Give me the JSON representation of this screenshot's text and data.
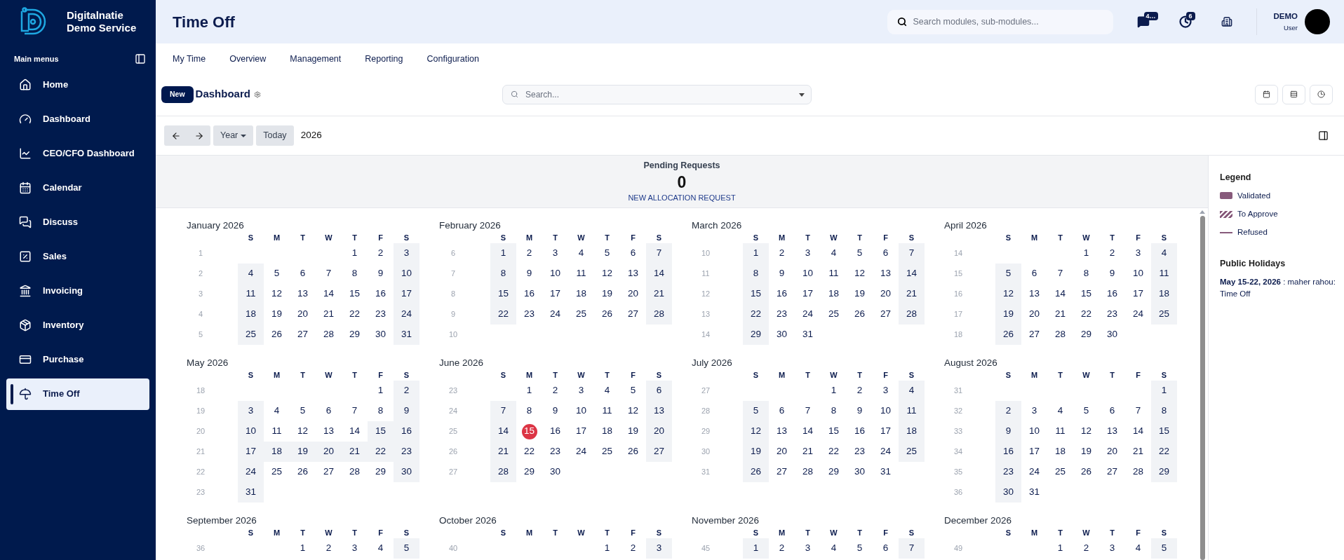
{
  "brand": {
    "lines": [
      "Digitalnatie",
      "Demo Service"
    ]
  },
  "sidebar": {
    "heading": "Main menus",
    "items": [
      {
        "label": "Home",
        "selected": false
      },
      {
        "label": "Dashboard",
        "selected": false
      },
      {
        "label": "CEO/CFO Dashboard",
        "selected": false
      },
      {
        "label": "Calendar",
        "selected": false
      },
      {
        "label": "Discuss",
        "selected": false
      },
      {
        "label": "Sales",
        "selected": false
      },
      {
        "label": "Invoicing",
        "selected": false
      },
      {
        "label": "Inventory",
        "selected": false
      },
      {
        "label": "Purchase",
        "selected": false
      },
      {
        "label": "Time Off",
        "selected": true
      }
    ]
  },
  "header": {
    "title": "Time Off",
    "search": {
      "placeholder": "Search modules, sub-modules..."
    },
    "messages_badge": "4…",
    "activity_badge": "6",
    "user": {
      "name": "DEMO",
      "role": "User"
    }
  },
  "menu": [
    "My Time",
    "Overview",
    "Management",
    "Reporting",
    "Configuration"
  ],
  "control_panel": {
    "new_button": "New",
    "title": "Dashboard",
    "search": {
      "placeholder": "Search..."
    }
  },
  "toolbar": {
    "scale": "Year",
    "today": "Today",
    "period": "2026"
  },
  "pending": {
    "label": "Pending Requests",
    "count": "0",
    "link": "NEW ALLOCATION REQUEST"
  },
  "months": [
    {
      "title": "January 2026",
      "weekdays": [
        "S",
        "M",
        "T",
        "W",
        "T",
        "F",
        "S"
      ],
      "weeks": [
        {
          "number": "1",
          "days": [
            "1",
            "2",
            "3"
          ]
        },
        {
          "number": "2",
          "days": [
            "4",
            "5",
            "6",
            "7",
            "8",
            "9",
            "10"
          ]
        },
        {
          "number": "3",
          "days": [
            "11",
            "12",
            "13",
            "14",
            "15",
            "16",
            "17"
          ]
        },
        {
          "number": "4",
          "days": [
            "18",
            "19",
            "20",
            "21",
            "22",
            "23",
            "24"
          ]
        },
        {
          "number": "5",
          "days": [
            "25",
            "26",
            "27",
            "28",
            "29",
            "30",
            "31"
          ]
        }
      ]
    },
    {
      "title": "February 2026",
      "weekdays": [
        "S",
        "M",
        "T",
        "W",
        "T",
        "F",
        "S"
      ],
      "weeks": [
        {
          "number": "6",
          "days": [
            "1",
            "2",
            "3",
            "4",
            "5",
            "6",
            "7"
          ]
        },
        {
          "number": "7",
          "days": [
            "8",
            "9",
            "10",
            "11",
            "12",
            "13",
            "14"
          ]
        },
        {
          "number": "8",
          "days": [
            "15",
            "16",
            "17",
            "18",
            "19",
            "20",
            "21"
          ]
        },
        {
          "number": "9",
          "days": [
            "22",
            "23",
            "24",
            "25",
            "26",
            "27",
            "28"
          ]
        },
        {
          "number": "10"
        }
      ]
    },
    {
      "title": "March 2026",
      "weekdays": [
        "S",
        "M",
        "T",
        "W",
        "T",
        "F",
        "S"
      ],
      "weeks": [
        {
          "number": "10",
          "days": [
            "1",
            "2",
            "3",
            "4",
            "5",
            "6",
            "7"
          ]
        },
        {
          "number": "11",
          "days": [
            "8",
            "9",
            "10",
            "11",
            "12",
            "13",
            "14"
          ]
        },
        {
          "number": "12",
          "days": [
            "15",
            "16",
            "17",
            "18",
            "19",
            "20",
            "21"
          ]
        },
        {
          "number": "13",
          "days": [
            "22",
            "23",
            "24",
            "25",
            "26",
            "27",
            "28"
          ]
        },
        {
          "number": "14",
          "days": [
            "29",
            "30",
            "31"
          ]
        }
      ]
    },
    {
      "title": "April 2026",
      "weekdays": [
        "S",
        "M",
        "T",
        "W",
        "T",
        "F",
        "S"
      ],
      "weeks": [
        {
          "number": "14",
          "days": [
            "1",
            "2",
            "3",
            "4"
          ]
        },
        {
          "number": "15",
          "days": [
            "5",
            "6",
            "7",
            "8",
            "9",
            "10",
            "11"
          ]
        },
        {
          "number": "16",
          "days": [
            "12",
            "13",
            "14",
            "15",
            "16",
            "17",
            "18"
          ]
        },
        {
          "number": "17",
          "days": [
            "19",
            "20",
            "21",
            "22",
            "23",
            "24",
            "25"
          ]
        },
        {
          "number": "18",
          "days": [
            "26",
            "27",
            "28",
            "29",
            "30"
          ]
        }
      ]
    },
    {
      "title": "May 2026",
      "weekdays": [
        "S",
        "M",
        "T",
        "W",
        "T",
        "F",
        "S"
      ],
      "weeks": [
        {
          "number": "18",
          "days": [
            "1",
            "2"
          ]
        },
        {
          "number": "19",
          "days": [
            "3",
            "4",
            "5",
            "6",
            "7",
            "8",
            "9"
          ]
        },
        {
          "number": "20",
          "days": [
            "10",
            {
              "day": "11",
              "holiday": false
            },
            {
              "day": "12",
              "holiday": false
            },
            {
              "day": "13",
              "holiday": false
            },
            {
              "day": "14",
              "holiday": false
            },
            {
              "day": "15",
              "holiday": true
            },
            "16"
          ]
        },
        {
          "number": "21",
          "days": [
            "17",
            {
              "day": "18",
              "holiday": true
            },
            {
              "day": "19",
              "holiday": true
            },
            {
              "day": "20",
              "holiday": true
            },
            {
              "day": "21",
              "holiday": true
            },
            {
              "day": "22",
              "holiday": true
            },
            "23"
          ]
        },
        {
          "number": "22",
          "days": [
            "24",
            "25",
            "26",
            "27",
            "28",
            "29",
            "30"
          ]
        },
        {
          "number": "23",
          "days": [
            "31"
          ]
        }
      ]
    },
    {
      "title": "June 2026",
      "weekdays": [
        "S",
        "M",
        "T",
        "W",
        "T",
        "F",
        "S"
      ],
      "weeks": [
        {
          "number": "23",
          "days": [
            "1",
            "2",
            "3",
            "4",
            "5",
            "6"
          ]
        },
        {
          "number": "24",
          "days": [
            "7",
            "8",
            "9",
            "10",
            "11",
            "12",
            "13"
          ]
        },
        {
          "number": "25",
          "days": [
            {
              "day": "14",
              "today": false
            },
            {
              "day": "15",
              "today": true
            },
            {
              "day": "16",
              "today": false
            },
            {
              "day": "17",
              "today": false
            },
            {
              "day": "18",
              "today": false
            },
            {
              "day": "19",
              "today": false
            },
            {
              "day": "20",
              "today": false
            }
          ]
        },
        {
          "number": "26",
          "days": [
            "21",
            "22",
            "23",
            "24",
            "25",
            "26",
            "27"
          ]
        },
        {
          "number": "27",
          "days": [
            "28",
            "29",
            "30"
          ]
        }
      ]
    },
    {
      "title": "July 2026",
      "weekdays": [
        "S",
        "M",
        "T",
        "W",
        "T",
        "F",
        "S"
      ],
      "weeks": [
        {
          "number": "27",
          "days": [
            "1",
            "2",
            "3",
            "4"
          ]
        },
        {
          "number": "28",
          "days": [
            "5",
            "6",
            "7",
            "8",
            "9",
            "10",
            "11"
          ]
        },
        {
          "number": "29",
          "days": [
            "12",
            "13",
            "14",
            "15",
            "16",
            "17",
            "18"
          ]
        },
        {
          "number": "30",
          "days": [
            "19",
            "20",
            "21",
            "22",
            "23",
            "24",
            "25"
          ]
        },
        {
          "number": "31",
          "days": [
            "26",
            "27",
            "28",
            "29",
            "30",
            "31"
          ]
        }
      ]
    },
    {
      "title": "August 2026",
      "weekdays": [
        "S",
        "M",
        "T",
        "W",
        "T",
        "F",
        "S"
      ],
      "weeks": [
        {
          "number": "31",
          "days": [
            "1"
          ]
        },
        {
          "number": "32",
          "days": [
            "2",
            "3",
            "4",
            "5",
            "6",
            "7",
            "8"
          ]
        },
        {
          "number": "33",
          "days": [
            "9",
            "10",
            "11",
            "12",
            "13",
            "14",
            "15"
          ]
        },
        {
          "number": "34",
          "days": [
            "16",
            "17",
            "18",
            "19",
            "20",
            "21",
            "22"
          ]
        },
        {
          "number": "35",
          "days": [
            "23",
            "24",
            "25",
            "26",
            "27",
            "28",
            "29"
          ]
        },
        {
          "number": "36",
          "days": [
            "30",
            "31"
          ]
        }
      ]
    },
    {
      "title": "September 2026",
      "weekdays": [
        "S",
        "M",
        "T",
        "W",
        "T",
        "F",
        "S"
      ],
      "weeks": [
        {
          "number": "36",
          "days": [
            "1",
            "2",
            "3",
            "4",
            "5"
          ]
        }
      ]
    },
    {
      "title": "October 2026",
      "weekdays": [
        "S",
        "M",
        "T",
        "W",
        "T",
        "F",
        "S"
      ],
      "weeks": [
        {
          "number": "40",
          "days": [
            "1",
            "2",
            "3"
          ]
        }
      ]
    },
    {
      "title": "November 2026",
      "weekdays": [
        "S",
        "M",
        "T",
        "W",
        "T",
        "F",
        "S"
      ],
      "weeks": [
        {
          "number": "45",
          "days": [
            "1",
            "2",
            "3",
            "4",
            "5",
            "6",
            "7"
          ]
        }
      ]
    },
    {
      "title": "December 2026",
      "weekdays": [
        "S",
        "M",
        "T",
        "W",
        "T",
        "F",
        "S"
      ],
      "weeks": [
        {
          "number": "49",
          "days": [
            "1",
            "2",
            "3",
            "4",
            "5"
          ]
        }
      ]
    }
  ],
  "legend": {
    "title": "Legend",
    "items": [
      {
        "kind": "solid",
        "label": "Validated",
        "color": "#875a7b"
      },
      {
        "kind": "striped",
        "label": "To Approve",
        "color": "#875a7b"
      },
      {
        "kind": "line",
        "label": "Refused",
        "color": "#875a7b"
      }
    ]
  },
  "public_holidays": {
    "title": "Public Holidays",
    "entries": [
      "**May 15-22, 2026** : maher rahou: Time Off"
    ]
  }
}
